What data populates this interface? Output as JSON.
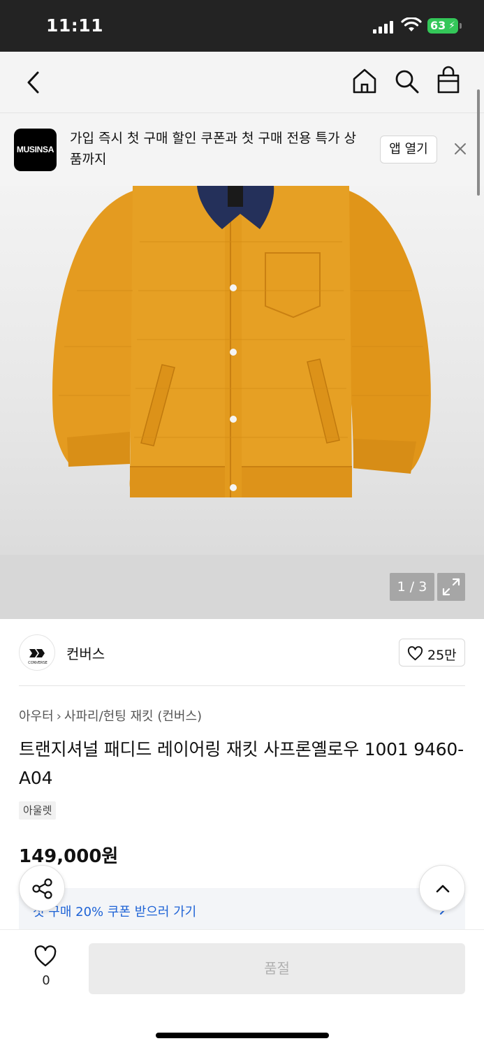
{
  "status_bar": {
    "time": "11:11",
    "battery": "63"
  },
  "header": {
    "icons": [
      "back-arrow-icon",
      "home-icon",
      "search-icon",
      "shopping-bag-icon"
    ]
  },
  "app_banner": {
    "logo_text": "MUSINSA",
    "message": "가입 즉시 첫 구매 할인 쿠폰과 첫 구매 전용 특가 상품까지",
    "open_button": "앱 열기"
  },
  "gallery": {
    "counter": "1 / 3"
  },
  "brand": {
    "name": "컨버스",
    "logo_text": "CONVERSE",
    "likes": "25만"
  },
  "product": {
    "breadcrumb": [
      "아우터",
      "사파리/헌팅 재킷 (컨버스)"
    ],
    "title": "트랜지셔널 패디드 레이어링 재킷 사프론옐로우 1001 9460-A04",
    "badge": "아울렛",
    "price": "149,000원"
  },
  "coupon": {
    "text": "첫 구매 20% 쿠폰 받으러 가기"
  },
  "bottom_bar": {
    "wish_count": "0",
    "soldout_label": "품절"
  },
  "colors": {
    "accent_blue": "#1e63d6",
    "jacket": "#e39a1f",
    "collar": "#24305a",
    "battery_green": "#34c759"
  }
}
